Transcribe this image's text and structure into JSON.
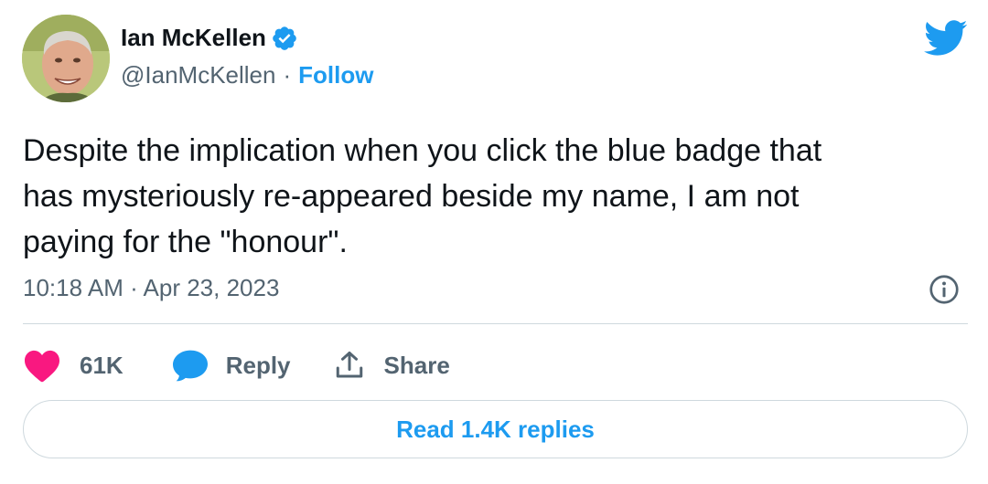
{
  "author": {
    "display_name": "Ian McKellen",
    "handle": "@IanMcKellen",
    "separator": "·",
    "follow_label": "Follow",
    "avatar_icon": "person-photo",
    "verified_icon": "verified-badge-icon"
  },
  "platform_icon": "twitter-bird-icon",
  "tweet": {
    "text": "Despite the implication when you click the blue badge that\nhas mysteriously re-appeared beside my name, I am not\npaying for the \"honour\".",
    "timestamp": "10:18 AM · Apr 23, 2023"
  },
  "actions": {
    "like_count": "61K",
    "reply_label": "Reply",
    "share_label": "Share"
  },
  "footer": {
    "read_replies_label": "Read 1.4K replies"
  },
  "colors": {
    "accent": "#1d9bf0",
    "like": "#f91880",
    "secondary_text": "#536471",
    "border": "#cfd9de"
  }
}
